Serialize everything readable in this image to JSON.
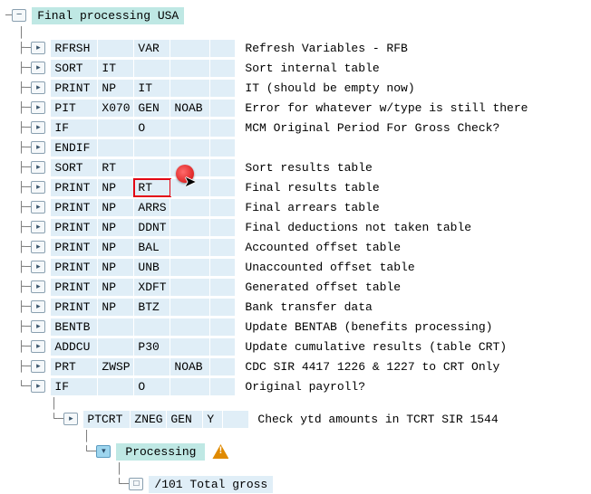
{
  "header": {
    "title": "Final processing USA"
  },
  "rows": [
    {
      "c1": "RFRSH",
      "c2": "",
      "c3": "VAR",
      "c4": "",
      "c5": "",
      "desc": "Refresh Variables - RFB"
    },
    {
      "c1": "SORT",
      "c2": "IT",
      "c3": "",
      "c4": "",
      "c5": "",
      "desc": "Sort internal table"
    },
    {
      "c1": "PRINT",
      "c2": "NP",
      "c3": "IT",
      "c4": "",
      "c5": "",
      "desc": "IT (should be empty now)"
    },
    {
      "c1": "PIT",
      "c2": "X070",
      "c3": "GEN",
      "c4": "NOAB",
      "c5": "",
      "desc": "Error for whatever w/type is still there"
    },
    {
      "c1": "IF",
      "c2": "",
      "c3": "O",
      "c4": "",
      "c5": "",
      "desc": "MCM Original Period For Gross Check?"
    },
    {
      "c1": "ENDIF",
      "c2": "",
      "c3": "",
      "c4": "",
      "c5": "",
      "desc": ""
    },
    {
      "c1": "SORT",
      "c2": "RT",
      "c3": "",
      "c4": "",
      "c5": "",
      "desc": "Sort results table"
    },
    {
      "c1": "PRINT",
      "c2": "NP",
      "c3": "RT",
      "c4": "",
      "c5": "",
      "desc": "Final results table",
      "hl3": true
    },
    {
      "c1": "PRINT",
      "c2": "NP",
      "c3": "ARRS",
      "c4": "",
      "c5": "",
      "desc": "Final arrears table"
    },
    {
      "c1": "PRINT",
      "c2": "NP",
      "c3": "DDNT",
      "c4": "",
      "c5": "",
      "desc": "Final deductions not taken table"
    },
    {
      "c1": "PRINT",
      "c2": "NP",
      "c3": "BAL",
      "c4": "",
      "c5": "",
      "desc": "Accounted offset table"
    },
    {
      "c1": "PRINT",
      "c2": "NP",
      "c3": "UNB",
      "c4": "",
      "c5": "",
      "desc": "Unaccounted offset table"
    },
    {
      "c1": "PRINT",
      "c2": "NP",
      "c3": "XDFT",
      "c4": "",
      "c5": "",
      "desc": "Generated offset table"
    },
    {
      "c1": "PRINT",
      "c2": "NP",
      "c3": "BTZ",
      "c4": "",
      "c5": "",
      "desc": "Bank transfer data"
    },
    {
      "c1": "BENTB",
      "c2": "",
      "c3": "",
      "c4": "",
      "c5": "",
      "desc": "Update BENTAB (benefits processing)"
    },
    {
      "c1": "ADDCU",
      "c2": "",
      "c3": "P30",
      "c4": "",
      "c5": "",
      "desc": "Update cumulative results (table CRT)"
    },
    {
      "c1": "PRT",
      "c2": "ZWSP",
      "c3": "",
      "c4": "NOAB",
      "c5": "",
      "desc": "CDC SIR 4417 1226 & 1227 to CRT Only"
    },
    {
      "c1": "IF",
      "c2": "",
      "c3": "O",
      "c4": "",
      "c5": "",
      "desc": "Original payroll?"
    }
  ],
  "subrow": {
    "c1": "PTCRT",
    "c2": "ZNEG",
    "c3": "GEN",
    "c4": "Y",
    "c5": "",
    "desc": "Check ytd amounts in TCRT SIR 1544"
  },
  "processing": {
    "label": "Processing"
  },
  "leaf": {
    "label": "/101 Total gross"
  }
}
